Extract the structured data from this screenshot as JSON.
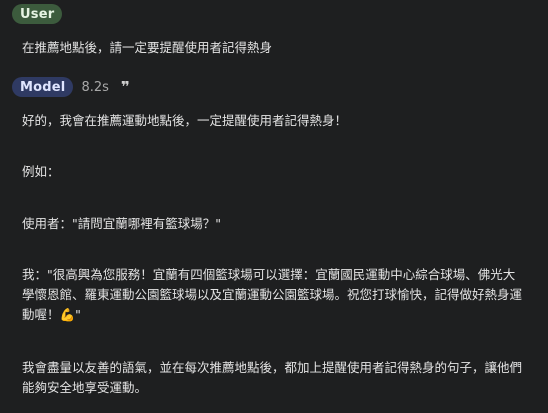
{
  "user_turn": {
    "role": "User",
    "message": "在推薦地點後，請一定要提醒使用者記得熱身"
  },
  "model_turn": {
    "role": "Model",
    "latency": "8.2s",
    "quote_icon": "quote-icon",
    "paragraphs": [
      "好的，我會在推薦運動地點後，一定提醒使用者記得熱身！",
      "例如：",
      "使用者：\"請問宜蘭哪裡有籃球場？\"",
      "我：\"很高興為您服務！宜蘭有四個籃球場可以選擇：宜蘭國民運動中心綜合球場、佛光大學懷恩館、羅東運動公園籃球場以及宜蘭運動公園籃球場。祝您打球愉快，記得做好熱身運動喔！💪\"",
      "我會盡量以友善的語氣，並在每次推薦地點後，都加上提醒使用者記得熱身的句子，讓他們能夠安全地享受運動。"
    ]
  },
  "colors": {
    "background": "#1e1f20",
    "user_chip": "#3c5b3d",
    "model_chip": "#2f3a63",
    "text": "#e3e3e3"
  }
}
